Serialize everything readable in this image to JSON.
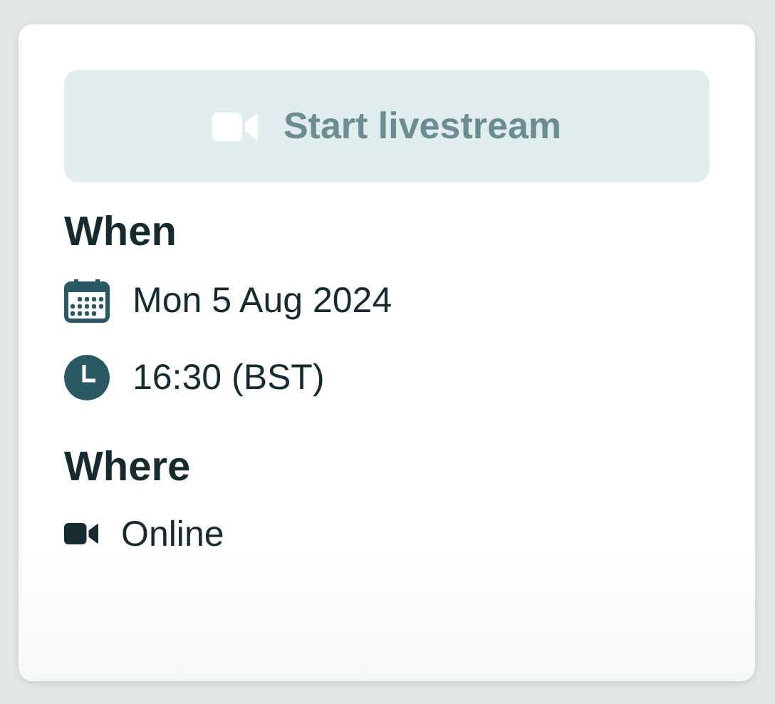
{
  "livestream_button": {
    "label": "Start livestream",
    "disabled": true
  },
  "sections": [
    {
      "heading": "When",
      "items": [
        {
          "kind": "date",
          "text": "Mon 5 Aug 2024"
        },
        {
          "kind": "time",
          "text": "16:30 (BST)"
        }
      ]
    },
    {
      "heading": "Where",
      "items": [
        {
          "kind": "video",
          "text": "Online"
        }
      ]
    }
  ]
}
